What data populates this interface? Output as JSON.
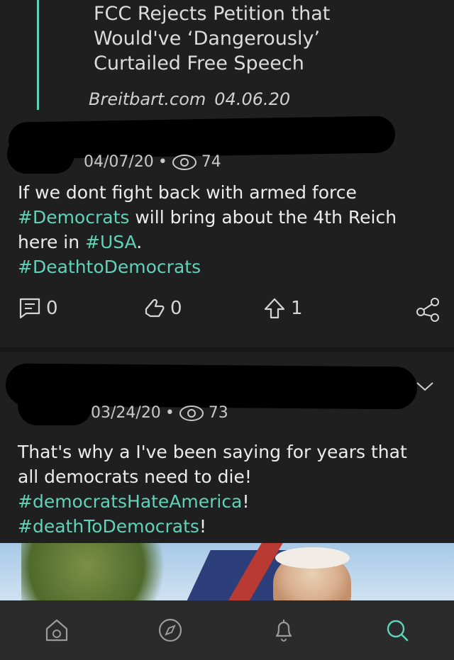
{
  "quoted_article": {
    "title": "FCC Rejects Petition that Would've ‘Dangerously’ Curtailed Free Speech",
    "source": "Breitbart.com",
    "date": "04.06.20"
  },
  "posts": [
    {
      "date": "04/07/20",
      "views": "74",
      "text_parts": [
        "If we dont fight back with armed force ",
        "#Democrats",
        " will bring about the 4th Reich here in ",
        "#USA",
        ".",
        "#DeathtoDemocrats"
      ],
      "actions": {
        "comments": "0",
        "reactions": "0",
        "reposts": "1"
      }
    },
    {
      "date": "03/24/20",
      "views": "73",
      "text_parts": [
        "That's why a I've been saying for years that all democrats need to die!",
        "#democratsHateAmerica",
        "!",
        "#deathToDemocrats",
        "!"
      ]
    }
  ],
  "nav": [
    "home-icon",
    "explore-icon",
    "notifications-icon",
    "search-icon"
  ],
  "colors": {
    "accent": "#5fd3b9",
    "background": "#1f1f1f"
  }
}
